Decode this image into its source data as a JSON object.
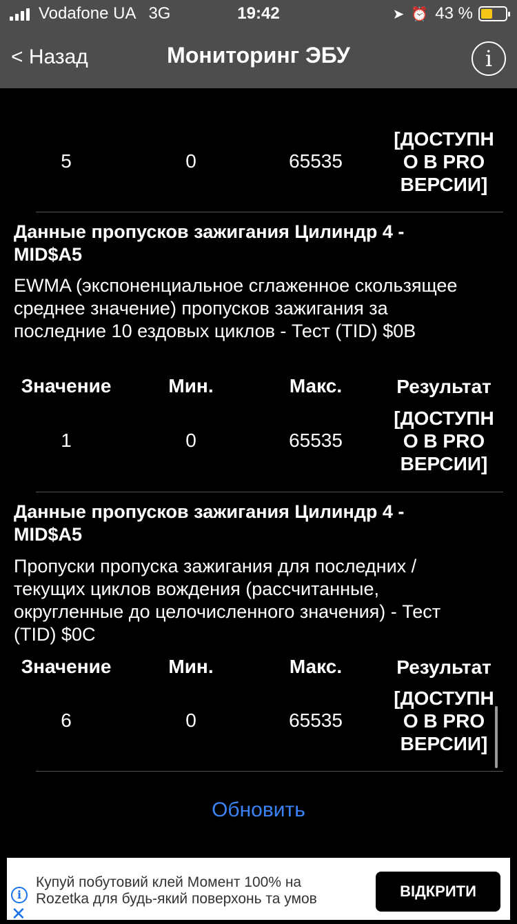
{
  "status_bar": {
    "carrier": "Vodafone UA",
    "network": "3G",
    "time": "19:42",
    "battery_percent": "43 %",
    "battery_level": 0.43
  },
  "nav": {
    "back_label": "< Назад",
    "title": "Мониторинг ЭБУ",
    "info_glyph": "i"
  },
  "top_row": {
    "value": "5",
    "min": "0",
    "max": "65535",
    "result_lines": [
      "[ДОСТУПН",
      "О В PRO",
      "ВЕРСИИ]"
    ]
  },
  "sections": [
    {
      "title_lines": [
        "Данные пропусков зажигания Цилиндр 4 -",
        "MID$A5"
      ],
      "desc_lines": [
        "EWMA (экспоненциальное сглаженное скользящее",
        "среднее значение) пропусков зажигания за",
        "последние 10 ездовых циклов - Тест (TID) $0B"
      ],
      "headers": [
        "Значение",
        "Мин.",
        "Макс.",
        "Результат"
      ],
      "value": "1",
      "min": "0",
      "max": "65535",
      "result_lines": [
        "[ДОСТУПН",
        "О В PRO",
        "ВЕРСИИ]"
      ]
    },
    {
      "title_lines": [
        "Данные пропусков зажигания Цилиндр 4 -",
        "MID$A5"
      ],
      "desc_lines": [
        "Пропуски пропуска зажигания для последних /",
        "текущих циклов вождения (рассчитанные,",
        "округленные до целочисленного значения) - Тест",
        "(TID) $0C"
      ],
      "headers": [
        "Значение",
        "Мин.",
        "Макс.",
        "Результат"
      ],
      "value": "6",
      "min": "0",
      "max": "65535",
      "result_lines": [
        "[ДОСТУПН",
        "О В PRO",
        "ВЕРСИИ]"
      ]
    }
  ],
  "refresh_label": "Обновить",
  "ad": {
    "text_lines": [
      "Купуй побутовий клей Момент 100% на",
      "Rozetka для будь-який поверхонь та умов"
    ],
    "button_label": "ВІДКРИТИ",
    "info_icon": "info-icon",
    "close_icon": "close-icon"
  },
  "colors": {
    "background": "#000000",
    "bars": "#4d4d4d",
    "link": "#3b82f6",
    "battery": "#f5c518"
  }
}
